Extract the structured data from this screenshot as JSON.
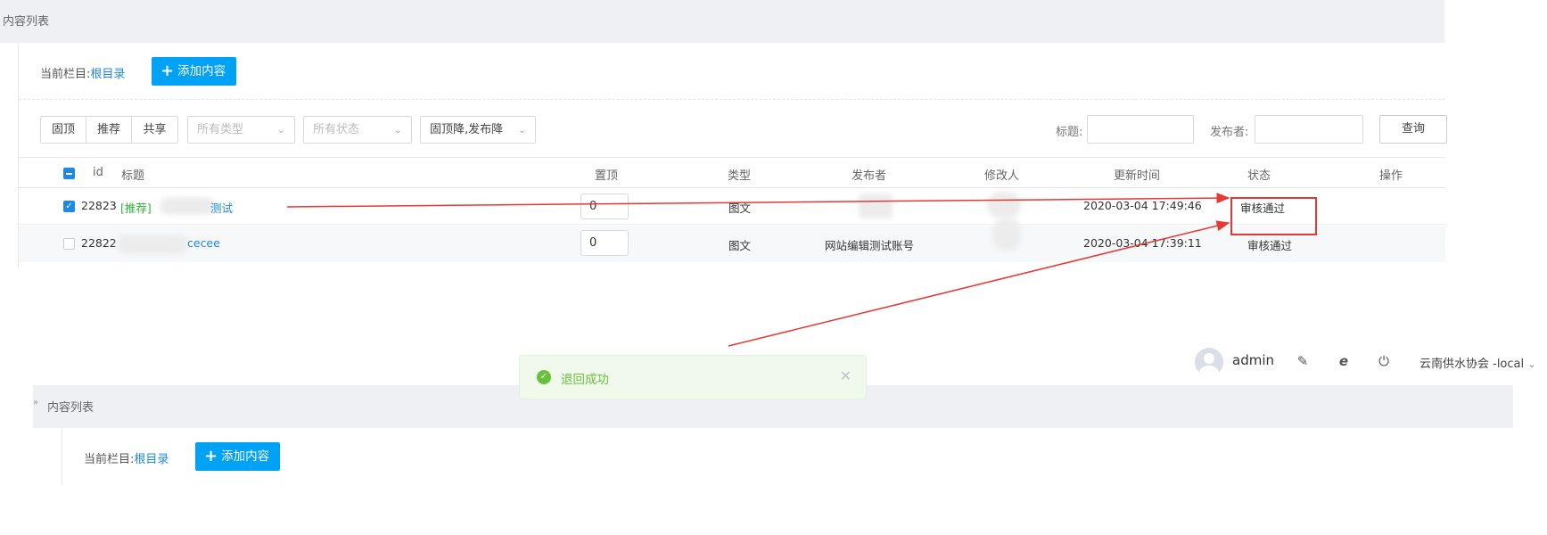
{
  "top": {
    "breadcrumb": "内容列表",
    "current_column_label": "当前栏目:",
    "current_column_value": "根目录",
    "add_button": "添加内容",
    "segments": [
      "固顶",
      "推荐",
      "共享"
    ],
    "type_select": "所有类型",
    "status_select": "所有状态",
    "sort_select": "固顶降,发布降",
    "title_label": "标题:",
    "publisher_label": "发布者:",
    "query_button": "查询",
    "columns": {
      "id": "id",
      "title": "标题",
      "top": "置顶",
      "type": "类型",
      "publisher": "发布者",
      "modifier": "修改人",
      "updated": "更新时间",
      "status": "状态",
      "actions": "操作"
    },
    "rows": [
      {
        "id": "22823",
        "tag": "[推荐]",
        "title_suffix": "测试",
        "top": "0",
        "type": "图文",
        "publisher": "",
        "modifier": "",
        "updated": "2020-03-04 17:49:46",
        "status": "审核通过",
        "checked": true
      },
      {
        "id": "22822",
        "tag": "",
        "title_suffix": "cecee",
        "top": "0",
        "type": "图文",
        "publisher": "网站编辑测试账号",
        "modifier": "",
        "updated": "2020-03-04 17:39:11",
        "status": "审核通过",
        "checked": false
      }
    ]
  },
  "toast": {
    "message": "退回成功"
  },
  "user": {
    "name": "admin",
    "site": "云南供水协会 -local"
  },
  "bottom": {
    "breadcrumb": "内容列表",
    "current_column_label": "当前栏目:",
    "current_column_value": "根目录",
    "add_button": "添加内容"
  },
  "colors": {
    "accent": "#00a2f5",
    "annotation": "#e53935",
    "success": "#67c23a"
  }
}
